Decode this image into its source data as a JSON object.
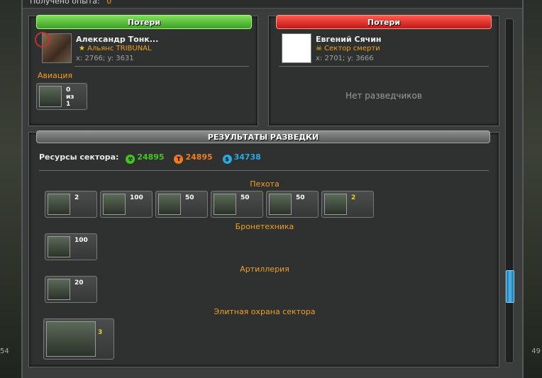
{
  "top": {
    "label": "Получено опыта:",
    "value": "0"
  },
  "attacker": {
    "header": "Потери",
    "name": "Александр Тонк...",
    "alliance": "Альянс TRIBUNAL",
    "coords": "x: 2766; y: 3631",
    "section": "Авиация",
    "units": [
      {
        "icon": "helicopter-icon",
        "count_lines": [
          "0",
          "из",
          "1"
        ]
      }
    ]
  },
  "defender": {
    "header": "Потери",
    "name": "Евгений Сячин",
    "alliance": "Сектор смерти",
    "coords": "x: 2701; y: 3666",
    "empty": "Нет разведчиков"
  },
  "recon": {
    "header": "РЕЗУЛЬТАТЫ РАЗВЕДКИ",
    "resources_label": "Ресурсы сектора:",
    "resources": [
      {
        "icon": "radiation-icon",
        "value": "24895",
        "color": "#46c41e"
      },
      {
        "icon": "titanium-icon",
        "value": "24895",
        "color": "#f07a20"
      },
      {
        "icon": "credits-icon",
        "value": "34738",
        "color": "#2aa8e0"
      }
    ],
    "infantry_label": "Пехота",
    "infantry": [
      {
        "icon": "soldier-icon",
        "count": "2"
      },
      {
        "icon": "drone-icon",
        "count": "100"
      },
      {
        "icon": "soldier-icon",
        "count": "50"
      },
      {
        "icon": "sniper-icon",
        "count": "50"
      },
      {
        "icon": "soldier-icon",
        "count": "50"
      },
      {
        "icon": "heavy-soldier-icon",
        "count": "2"
      }
    ],
    "armor_label": "Бронетехника",
    "armor": [
      {
        "icon": "tank-icon",
        "count": "100"
      }
    ],
    "artillery_label": "Артиллерия",
    "artillery": [
      {
        "icon": "artillery-icon",
        "count": "20"
      }
    ],
    "elite_label": "Элитная охрана сектора",
    "elite": [
      {
        "icon": "mech-icon",
        "count": "3"
      }
    ]
  },
  "side": {
    "left": "54",
    "right": "49"
  },
  "colors": {
    "accent": "#f0a020",
    "scroll": "#4fb8f0"
  }
}
